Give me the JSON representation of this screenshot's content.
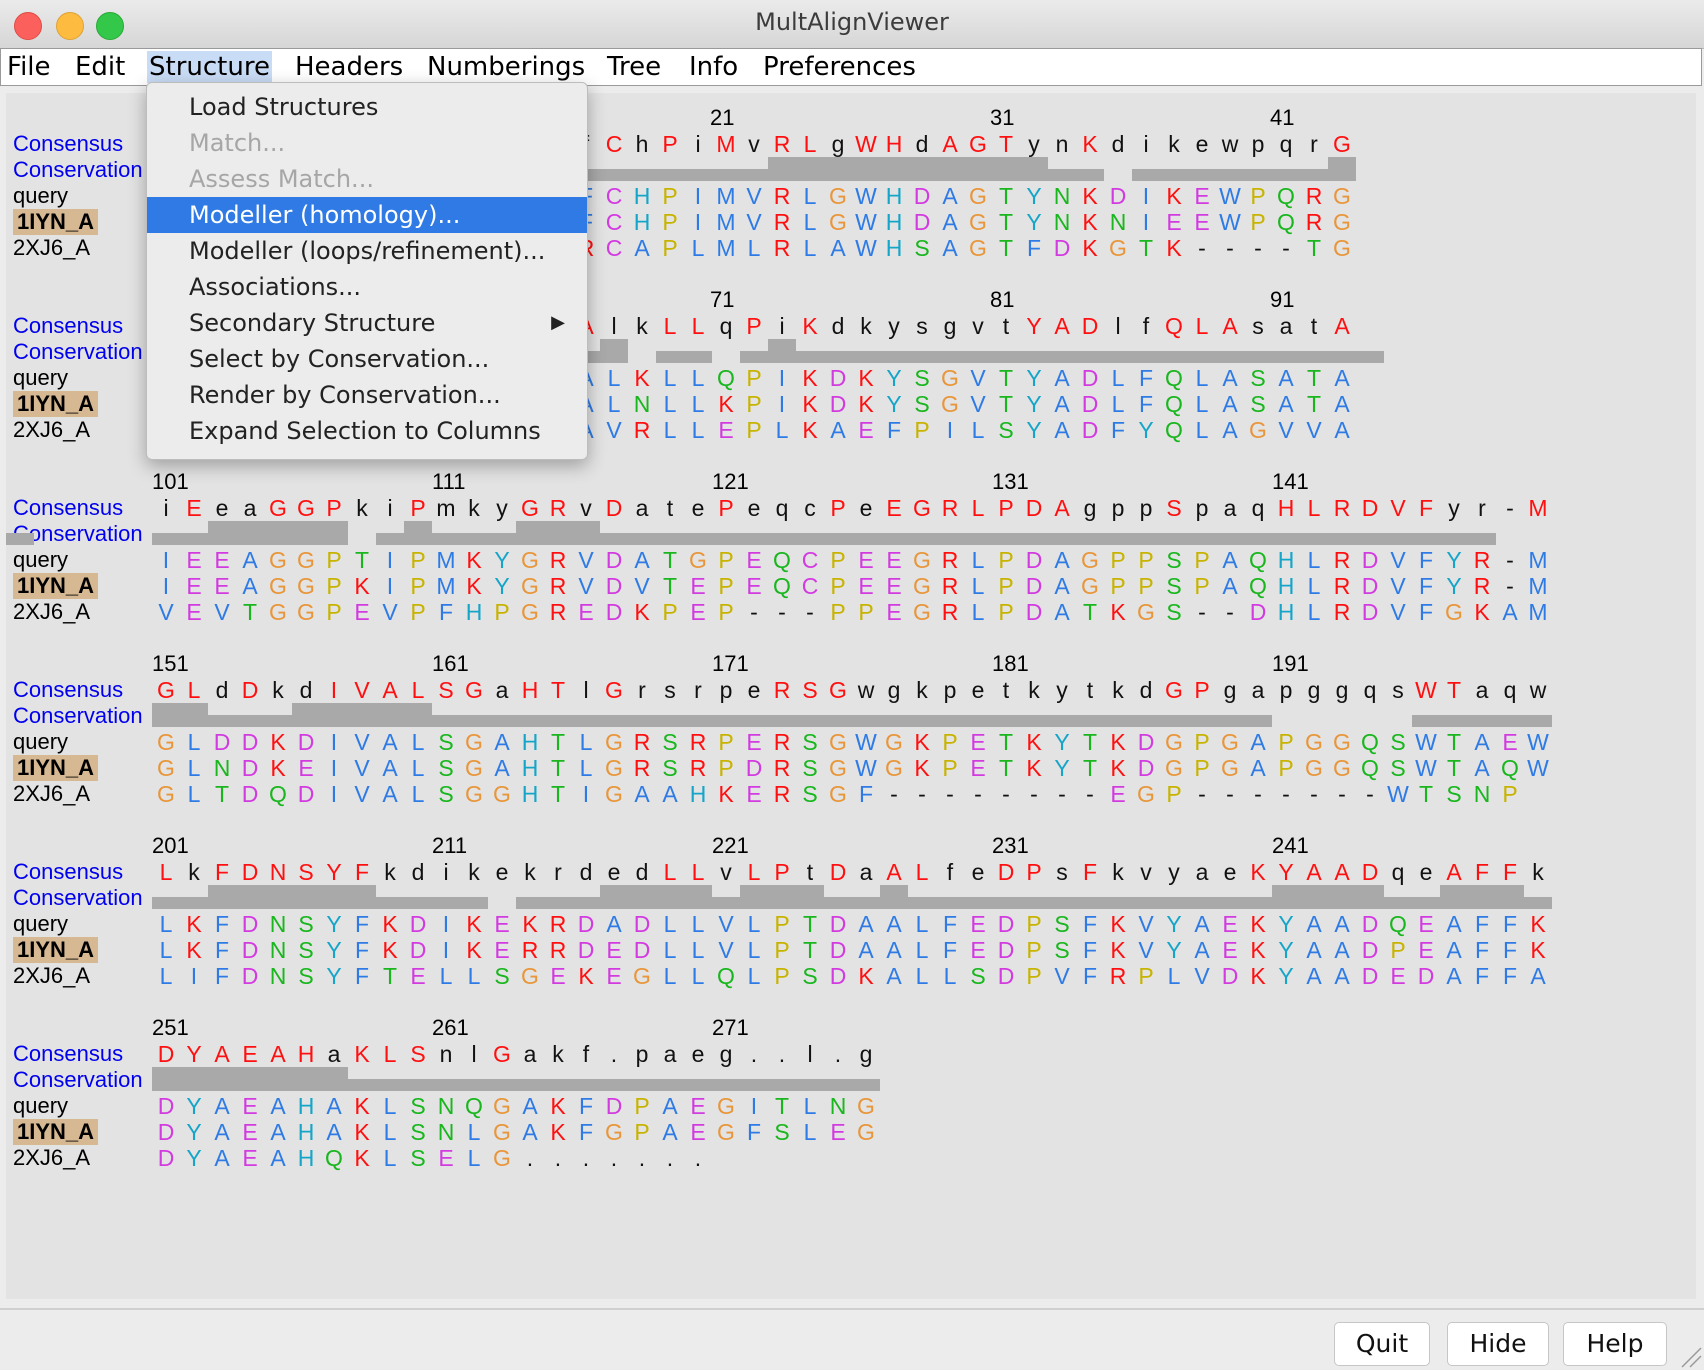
{
  "window": {
    "title": "MultAlignViewer"
  },
  "menubar": [
    "File",
    "Edit",
    "Structure",
    "Headers",
    "Numberings",
    "Tree",
    "Info",
    "Preferences"
  ],
  "active_menu": "Structure",
  "dropdown": {
    "items": [
      {
        "label": "Load Structures",
        "disabled": false
      },
      {
        "label": "Match...",
        "disabled": true
      },
      {
        "label": "Assess Match...",
        "disabled": true
      },
      {
        "label": "Modeller (homology)...",
        "disabled": false,
        "selected": true
      },
      {
        "label": "Modeller (loops/refinement)...",
        "disabled": false
      },
      {
        "label": "Associations...",
        "disabled": false
      },
      {
        "label": "Secondary Structure",
        "disabled": false,
        "submenu": true
      },
      {
        "label": "Select by Conservation...",
        "disabled": false
      },
      {
        "label": "Render by Conservation...",
        "disabled": false
      },
      {
        "label": "Expand Selection to Columns",
        "disabled": false
      }
    ],
    "submenu_arrow": "▶"
  },
  "row_labels": [
    "Consensus",
    "Conservation",
    "query",
    "1IYN_A",
    "2XJ6_A"
  ],
  "blocks": [
    {
      "numbers": [
        "21",
        "31",
        "41"
      ],
      "consensus": "?????????ellqsKfChPiMvRLgWHdAGTynKdikewpqrG",
      "query": "?????????ELLQSKFCHPIMVRLGWHDAGTYNKDIKEWPQRG",
      "s1": "?????????ELLKTKFCHPIMVRLGWHDAGTYNKNIEEWPQRG",
      "s2": "?????????GFIAEKRCAPLMLRLAWHSAGTFDKGTK----TG",
      "cons": "?????????0222111111111222222222213011111112"
    },
    {
      "numbers": [
        "71",
        "81",
        "91"
      ],
      "consensus": "?????????NaGLvnAlkLLqPiKdkysgvtYADlfQLAsatA",
      "query": "?????????NAGLVNALKLLQPIKDKYSGVTYADLFQLASATA",
      "s1": "?????????NAGLVNALNLLKPIKDKYSGVTYADLFQLASATA",
      "s2": "?????????NNGLDIAVRLLEPLKAEFPILSYADFYQLAGVVA",
      "cons": "?????????11110012011012111111111111111111111"
    },
    {
      "numbers": [
        "101",
        "111",
        "121",
        "131",
        "141"
      ],
      "consensus": "iEeaGGPkiPmkyGRvDatePeqcPeEGRLPDAgppSpaqHLRDVFyr-M",
      "query": "IEEAGGPTIPMKYGRVDATGPEQCPEEGRLPDAGPPSPAQHLRDVFYR-M",
      "s1": "IEEAGGPKIPMKYGRVDVTEPEQCPEEGRLPDAGPPSPAQHLRDVFYR-M",
      "s2": "VEVTGGPEVPFHPGREDKPEP---PPEGRLPDATKGS--DHLRDVFGKAM",
      "cons": "1122222012111222111111111111111111111111111111110 1"
    },
    {
      "numbers": [
        "151",
        "161",
        "171",
        "181",
        "191"
      ],
      "consensus": "GLdDkdIVALSGaHTlGrsrpeRSGwgkpetkytkdGPgapggqsWTaqw",
      "query": "GLDDKDIVALSGAHTLGRSRPERSGWGKPETKYTKDGPGAPGGQSWTAEW",
      "s1": "GLNDKEIVALSGAHTLGRSRPDRSGWGKPETKYTKDGPGAPGGQSWTAQW",
      "s2": "GLTDQDIVALSGGHTIGAAHKERSGF--------EGP-------WTSNP",
      "cons": "22111222221111111111111111111111111111110000011111"
    },
    {
      "numbers": [
        "201",
        "211",
        "221",
        "231",
        "241"
      ],
      "consensus": "LkFDNSYFkdikekrdedLLvLPtDaALfeDPsFkvyaeKYAADqeAFFk",
      "query": "LKFDNSYFKDIKEKRDADLLVLPTDAALFEDPSFKVYAEKYAADQEAFFK",
      "s1": "LKFDNSYFKDIKERRDEDLLVLPTDAALFEDPSFKVYAEKYAADPEAFFK",
      "s2": "LIFDNSYFTELLSGEKEGLLQLPSDKALLSDPVFRPLVDKYAADEDAFFA",
      "cons": "11222222111101112222122211211111111111112222112221"
    },
    {
      "numbers": [
        "251",
        "261",
        "271"
      ],
      "consensus": "DYAEAHaKLSnlGakf.paeg..l.g",
      "query": "DYAEAHAKLSNQGAKFDPAEGITLNG",
      "s1": "DYAEAHAKLSNLGAKFGPAEGFSLEG",
      "s2": "DYAEAHQKLSELG.......      ",
      "cons": "22222221111111111111111111"
    }
  ],
  "buttons": [
    "Quit",
    "Hide",
    "Help"
  ]
}
